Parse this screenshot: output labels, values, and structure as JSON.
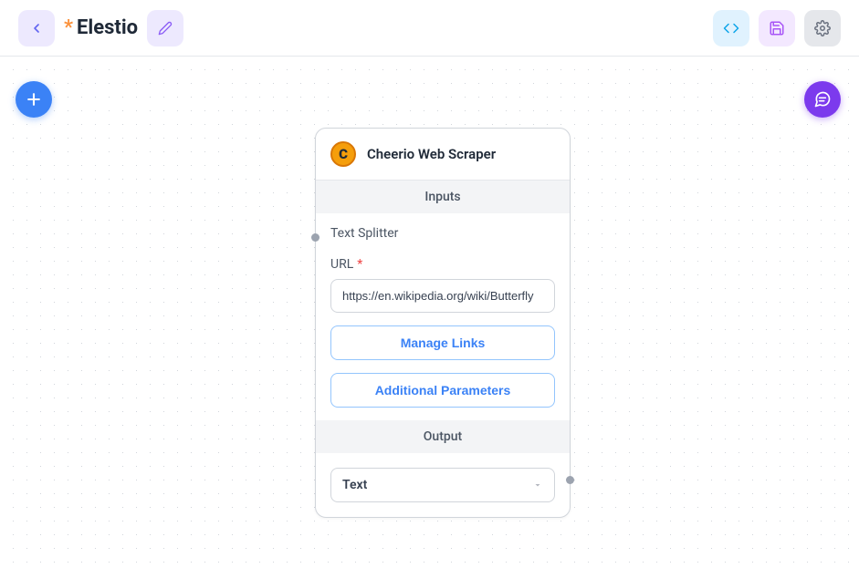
{
  "header": {
    "modified_indicator": "*",
    "title": "Elestio"
  },
  "node": {
    "title": "Cheerio Web Scraper",
    "sections": {
      "inputs_label": "Inputs",
      "output_label": "Output"
    },
    "inputs": {
      "text_splitter_label": "Text Splitter",
      "url_label": "URL",
      "url_value": "https://en.wikipedia.org/wiki/Butterfly",
      "manage_links_label": "Manage Links",
      "additional_params_label": "Additional Parameters"
    },
    "output": {
      "selected": "Text"
    }
  }
}
